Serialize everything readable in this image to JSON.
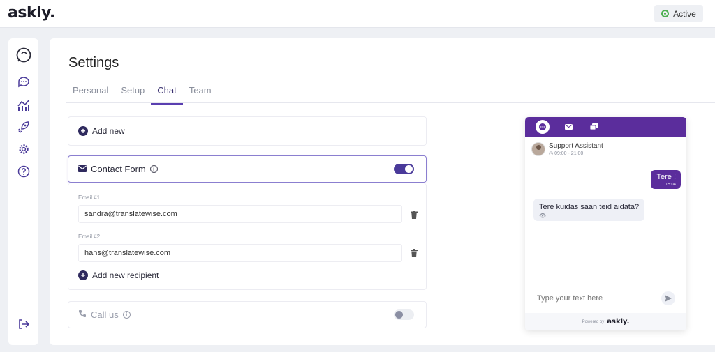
{
  "app": {
    "logo": "askly."
  },
  "header": {
    "status_label": "Active"
  },
  "sidebar": {
    "items": [
      {
        "icon": "chat-bubbles-icon"
      },
      {
        "icon": "chat-icon"
      },
      {
        "icon": "analytics-icon"
      },
      {
        "icon": "rocket-icon"
      },
      {
        "icon": "gear-icon"
      },
      {
        "icon": "help-icon"
      },
      {
        "icon": "logout-icon"
      }
    ]
  },
  "page": {
    "title": "Settings",
    "tabs": [
      {
        "label": "Personal"
      },
      {
        "label": "Setup"
      },
      {
        "label": "Chat",
        "active": true
      },
      {
        "label": "Team"
      }
    ]
  },
  "chat": {
    "add_new_label": "Add new",
    "contact_form": {
      "label": "Contact Form",
      "enabled": true,
      "emails": [
        {
          "label": "Email #1",
          "value": "sandra@translatewise.com"
        },
        {
          "label": "Email #2",
          "value": "hans@translatewise.com"
        }
      ],
      "add_recipient_label": "Add new recipient"
    },
    "call_us": {
      "label": "Call us",
      "enabled": false
    }
  },
  "preview": {
    "agent_name": "Support Assistant",
    "agent_hours": "09:00 - 21:00",
    "outgoing": {
      "text": "Tere !",
      "time": "15:04"
    },
    "incoming": {
      "text": "Tere kuidas saan teid aidata?"
    },
    "input_placeholder": "Type your text here",
    "powered_by": "Powered by",
    "powered_logo": "askly."
  },
  "colors": {
    "brand": "#5b2d9c",
    "accent": "#4a3a9a",
    "status_green": "#4caf50"
  }
}
